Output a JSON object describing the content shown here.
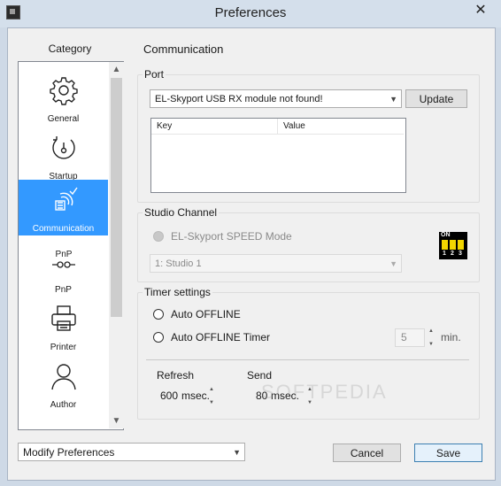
{
  "window": {
    "title": "Preferences",
    "close_glyph": "✕"
  },
  "sidebar": {
    "header": "Category",
    "items": [
      {
        "label": "General",
        "icon": "gear-icon"
      },
      {
        "label": "Startup",
        "icon": "startup-icon"
      },
      {
        "label": "Communication",
        "icon": "communication-icon",
        "selected": true
      },
      {
        "label": "PnP",
        "icon": "pnp-icon"
      },
      {
        "label": "Printer",
        "icon": "printer-icon"
      },
      {
        "label": "Author",
        "icon": "author-icon"
      }
    ],
    "scroll_up": "▲",
    "scroll_down": "▼"
  },
  "main": {
    "section_title": "Communication",
    "port": {
      "group_title": "Port",
      "selected_value": "EL-Skyport USB RX module not found!",
      "update_label": "Update",
      "table_headers": [
        "Key",
        "Value"
      ],
      "rows": []
    },
    "studio": {
      "group_title": "Studio Channel",
      "radio_label": "EL-Skyport SPEED Mode",
      "channel_value": "1:  Studio 1",
      "dip_on": "ON",
      "dip_numbers": [
        "1",
        "2",
        "3"
      ]
    },
    "timer": {
      "group_title": "Timer settings",
      "auto_offline": "Auto OFFLINE",
      "auto_offline_timer": "Auto OFFLINE Timer",
      "timer_value": "5",
      "timer_unit": "min.",
      "refresh_label": "Refresh",
      "refresh_value": "600",
      "refresh_unit": "msec.",
      "send_label": "Send",
      "send_value": "80",
      "send_unit": "msec."
    }
  },
  "footer": {
    "profile_value": "Modify Preferences",
    "cancel_label": "Cancel",
    "save_label": "Save"
  },
  "watermark": "SOFTPEDIA",
  "colors": {
    "selection": "#3399ff",
    "dip_switch": "#f2d600"
  }
}
